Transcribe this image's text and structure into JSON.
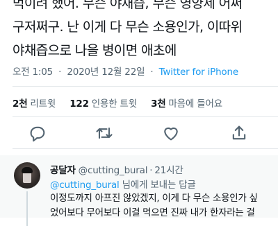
{
  "tweet": {
    "lines": [
      "먹이려 했어. 무슨 야채즙, 무슨 영양제 어쩌",
      "구저쩌구. 난 이게 다 무슨 소용인가, 이따위",
      "야채즙으로 나을 병이면 애초에"
    ],
    "time": "오전 1:05",
    "date": "2020년 12월 22일",
    "separator": "·",
    "client": "Twitter for iPhone"
  },
  "stats": {
    "retweets": {
      "count": "2천",
      "label": "리트윗"
    },
    "quotes": {
      "count": "122",
      "label": "인용한 트윗"
    },
    "likes": {
      "count": "3천",
      "label": "마음에 들어요"
    }
  },
  "actions": {
    "icons": [
      "reply-icon",
      "retweet-icon",
      "like-icon",
      "share-icon"
    ],
    "color": "#536471"
  },
  "reply": {
    "display_name": "공달자",
    "handle": "@cutting_bural",
    "dot": "·",
    "time": "21시간",
    "reply_to_mention": "@cutting_bural",
    "reply_to_suffix": " 님에게 보내는 답글",
    "body_lines": [
      "이정도까지 아프진 않았겠지, 이게 다 무슨 소용인가 싶",
      "었어보다 무어보다 이걸 먹으면 진짜 내가 한자라는 걸"
    ]
  },
  "colors": {
    "text": "#0f1419",
    "secondary": "#536471",
    "accent": "#1d9bf0",
    "divider": "#e3e7ea",
    "reply_bg": "#f7f9f9"
  }
}
